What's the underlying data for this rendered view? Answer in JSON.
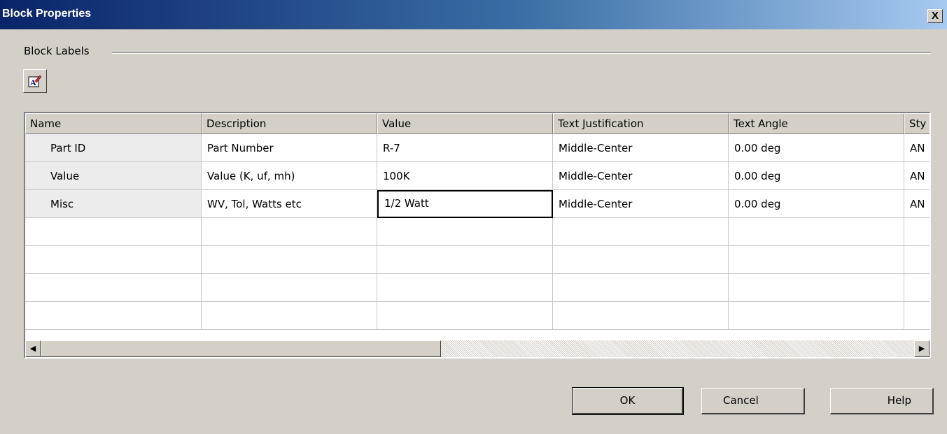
{
  "window": {
    "title": "Block Properties",
    "close_label": "X"
  },
  "group": {
    "label": "Block Labels"
  },
  "toolbar": {
    "edit_icon": "text-edit-icon"
  },
  "table": {
    "columns": [
      "Name",
      "Description",
      "Value",
      "Text Justification",
      "Text Angle",
      "Sty"
    ],
    "rows": [
      {
        "name": "Part ID",
        "description": "Part Number",
        "value": "R-7",
        "justification": "Middle-Center",
        "angle": "0.00 deg",
        "style": "AN"
      },
      {
        "name": "Value",
        "description": "Value (K, uf, mh)",
        "value": "100K",
        "justification": "Middle-Center",
        "angle": "0.00 deg",
        "style": "AN"
      },
      {
        "name": "Misc",
        "description": "WV, Tol, Watts etc",
        "value": "1/2 Watt",
        "justification": "Middle-Center",
        "angle": "0.00 deg",
        "style": "AN"
      }
    ]
  },
  "scrollbar": {
    "left_arrow": "◀",
    "right_arrow": "▶"
  },
  "buttons": {
    "ok": "OK",
    "cancel": "Cancel",
    "help": "Help"
  }
}
